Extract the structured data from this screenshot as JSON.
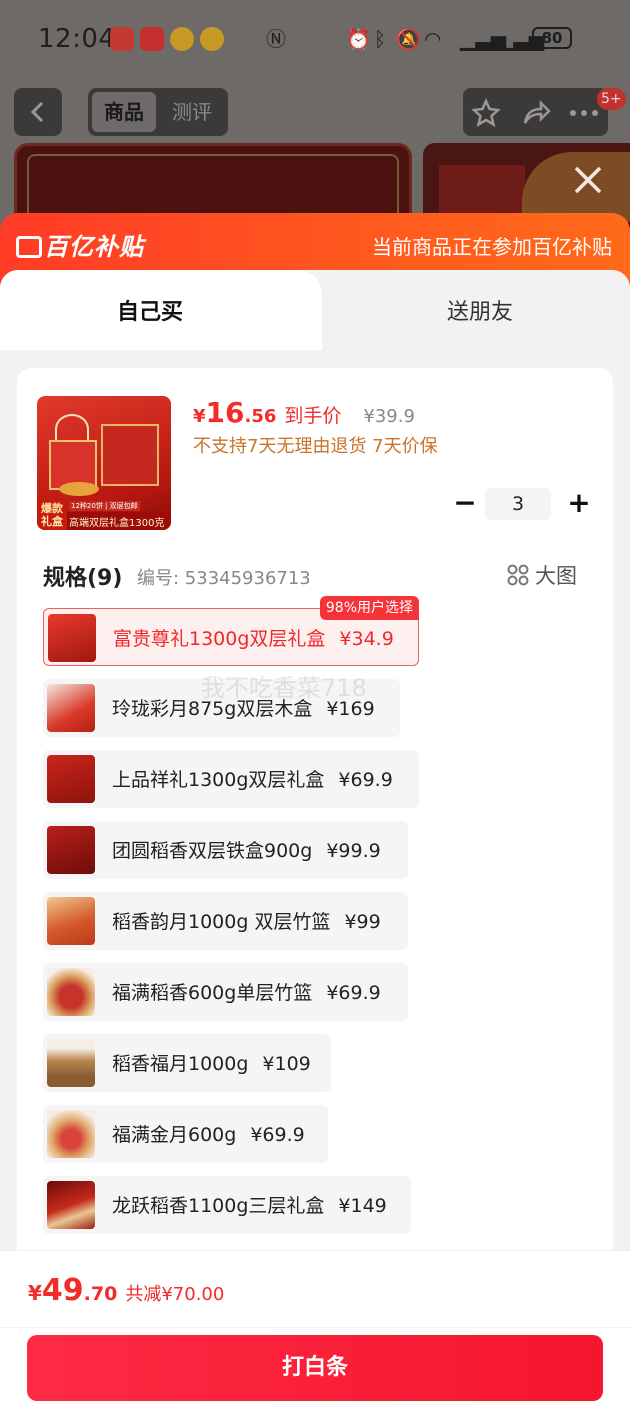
{
  "status_bar": {
    "time": "12:04",
    "battery": "80"
  },
  "top_nav": {
    "segment_active": "商品",
    "segment_inactive": "测评",
    "badge": "5+"
  },
  "subsidy_banner": {
    "logo_text": "百亿补贴",
    "message": "当前商品正在参加百亿补贴"
  },
  "tabs": {
    "self_buy": "自己买",
    "gift": "送朋友"
  },
  "product": {
    "thumb_tag_left": "爆款礼盒",
    "thumb_tag_text": "高端双层礼盒1300克",
    "thumb_tag_sub": "12种20饼 | 双层包邮",
    "price_currency": "¥",
    "price_int": "16",
    "price_dec": ".56",
    "price_label": "到手价",
    "original_price": "¥39.9",
    "policy": "不支持7天无理由退货  7天价保",
    "quantity": "3",
    "minus": "−",
    "plus": "+"
  },
  "spec": {
    "title": "规格(9)",
    "code": "编号: 53345936713",
    "big_pic": "大图",
    "watermark": "我不吃香菜718",
    "choice_badge": "98%用户选择",
    "variants": [
      {
        "name": "富贵尊礼1300g双层礼盒",
        "price": "¥34.9"
      },
      {
        "name": "玲珑彩月875g双层木盒",
        "price": "¥169"
      },
      {
        "name": "上品祥礼1300g双层礼盒",
        "price": "¥69.9"
      },
      {
        "name": "团圆稻香双层铁盒900g",
        "price": "¥99.9"
      },
      {
        "name": "稻香韵月1000g 双层竹篮",
        "price": "¥99"
      },
      {
        "name": "福满稻香600g单层竹篮",
        "price": "¥69.9"
      },
      {
        "name": "稻香福月1000g",
        "price": "¥109"
      },
      {
        "name": "福满金月600g",
        "price": "¥69.9"
      },
      {
        "name": "龙跃稻香1100g三层礼盒",
        "price": "¥149"
      }
    ]
  },
  "footer": {
    "total_currency": "¥",
    "total_int": "49",
    "total_dec": ".70",
    "total_save": "共减¥70.00",
    "pay_label": "打白条"
  },
  "colors": {
    "accent_red": "#f22b2b",
    "subsidy_orange": "#ff4a20",
    "policy_orange": "#c9742a"
  }
}
